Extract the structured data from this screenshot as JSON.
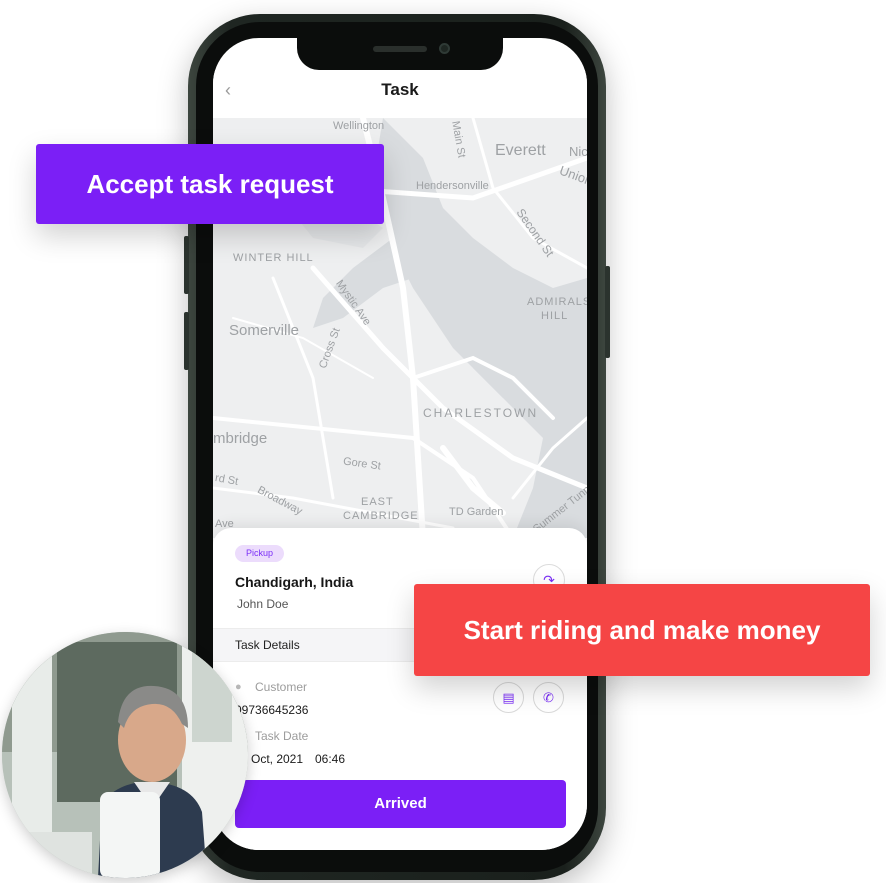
{
  "callouts": {
    "accept": "Accept task request",
    "start": "Start riding and make money"
  },
  "header": {
    "title": "Task",
    "back_icon": "chevron-left-icon"
  },
  "map": {
    "labels": [
      "Wellington",
      "Main St",
      "Everett",
      "Nic",
      "Union",
      "Hendersonville",
      "Second St",
      "WINTER HILL",
      "Mystic Ave",
      "ADMIRALS",
      "HILL",
      "Somerville",
      "Cross St",
      "CHARLESTOWN",
      "mbridge",
      "Gore St",
      "rd St",
      "Broadway",
      "EAST",
      "CAMBRIDGE",
      "TD Garden",
      "Summer Tunnel",
      "Ave"
    ]
  },
  "task": {
    "badge": "Pickup",
    "location": "Chandigarh, India",
    "name": "John Doe",
    "share_icon": "share-icon",
    "details_heading": "Task Details",
    "customer_label": "Customer",
    "customer_phone": "09736645236",
    "date_label": "Task Date",
    "date_value": "Oct, 2021",
    "time_value": "06:46",
    "message_icon": "chat-icon",
    "call_icon": "phone-icon",
    "arrived_label": "Arrived"
  },
  "colors": {
    "primary": "#7b1ff6",
    "callout_red": "#f54545",
    "badge_bg": "#ecdcfc"
  }
}
